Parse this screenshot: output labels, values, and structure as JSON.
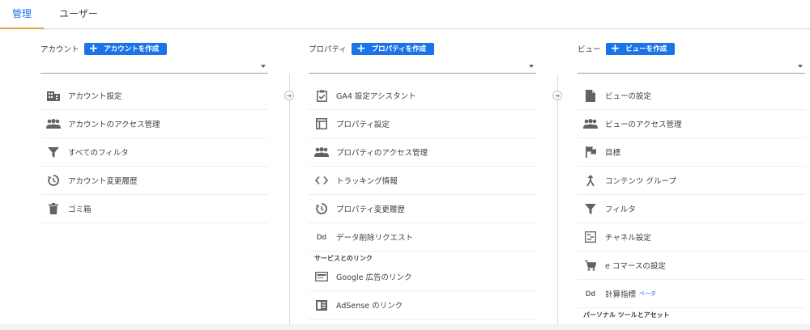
{
  "tabs": {
    "admin": "管理",
    "user": "ユーザー"
  },
  "account": {
    "label": "アカウント",
    "create": "アカウントを作成",
    "items": [
      {
        "label": "アカウント設定",
        "icon": "building-icon"
      },
      {
        "label": "アカウントのアクセス管理",
        "icon": "people-icon"
      },
      {
        "label": "すべてのフィルタ",
        "icon": "filter-icon"
      },
      {
        "label": "アカウント変更履歴",
        "icon": "history-icon"
      },
      {
        "label": "ゴミ箱",
        "icon": "trash-icon"
      }
    ]
  },
  "property": {
    "label": "プロパティ",
    "create": "プロパティを作成",
    "items": [
      {
        "label": "GA4 設定アシスタント",
        "icon": "clipboard-check-icon"
      },
      {
        "label": "プロパティ設定",
        "icon": "layout-icon"
      },
      {
        "label": "プロパティのアクセス管理",
        "icon": "people-icon"
      },
      {
        "label": "トラッキング情報",
        "icon": "code-icon"
      },
      {
        "label": "プロパティ変更履歴",
        "icon": "history-icon"
      },
      {
        "label": "データ削除リクエスト",
        "icon": "dd-icon",
        "glyph": "Dd"
      }
    ],
    "section": "サービスとのリンク",
    "links": [
      {
        "label": "Google 広告のリンク",
        "icon": "ads-icon"
      },
      {
        "label": "AdSense のリンク",
        "icon": "adsense-icon"
      }
    ]
  },
  "view": {
    "label": "ビュー",
    "create": "ビューを作成",
    "items": [
      {
        "label": "ビューの設定",
        "icon": "file-icon"
      },
      {
        "label": "ビューのアクセス管理",
        "icon": "people-icon"
      },
      {
        "label": "目標",
        "icon": "flag-icon"
      },
      {
        "label": "コンテンツ グループ",
        "icon": "merge-icon"
      },
      {
        "label": "フィルタ",
        "icon": "filter-icon"
      },
      {
        "label": "チャネル設定",
        "icon": "channel-icon"
      },
      {
        "label": "e コマースの設定",
        "icon": "cart-icon"
      },
      {
        "label": "計算指標",
        "icon": "dd-icon",
        "glyph": "Dd",
        "badge": "ベータ"
      }
    ],
    "section": "パーソナル ツールとアセット"
  },
  "colors": {
    "accent": "#1a73e8",
    "tab_underline": "#e8a33d",
    "icon": "#5f6368"
  }
}
